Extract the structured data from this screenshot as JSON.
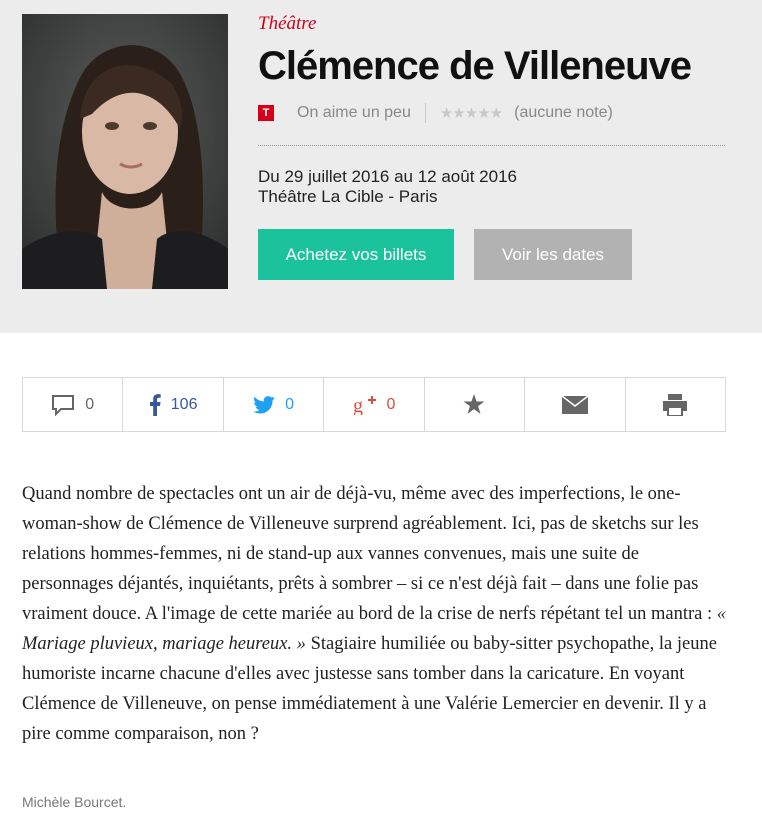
{
  "header": {
    "category": "Théâtre",
    "title": "Clémence de Villeneuve",
    "brand_badge": "T",
    "verdict": "On aime un peu",
    "stars": "★★★★★",
    "rating_note": "(aucune note)",
    "dates": "Du 29 juillet 2016 au 12 août 2016",
    "venue": "Théâtre La Cible - Paris",
    "buy_label": "Achetez vos billets",
    "dates_label": "Voir les dates"
  },
  "share": {
    "comments_count": "0",
    "facebook_count": "106",
    "twitter_count": "0",
    "googleplus_count": "0"
  },
  "article": {
    "text_before_quote": "Quand nombre de spectacles ont un air de déjà-vu, même avec des imperfections, le one-woman-show de Clémence de Villeneuve surprend agréablement. Ici, pas de sketchs sur les relations hommes-femmes, ni de stand-up aux vannes convenues, mais une suite de personnages déjantés, inquiétants, prêts à sombrer – si ce n'est déjà fait – dans une folie pas vraiment douce. A l'image de cette mariée au bord de la crise de nerfs répétant tel un mantra : ",
    "quote": "« Mariage pluvieux, mariage heureux. »",
    "text_after_quote": " Stagiaire humiliée ou baby-sitter psychopathe, la jeune humoriste incarne chacune d'elles avec justesse sans tomber dans la caricature. En voyant Clémence de Villeneuve, on pense immédiatement à une Valérie Lemercier en devenir. Il y a pire comme comparaison, non ?",
    "author": "Michèle Bourcet."
  },
  "colors": {
    "accent_red": "#d4001a",
    "buy_button": "#1bc39c",
    "dates_button": "#b2b2b2",
    "hero_background": "#ececec"
  },
  "icons": [
    "comment-icon",
    "facebook-icon",
    "twitter-icon",
    "googleplus-icon",
    "favorite-star-icon",
    "email-icon",
    "print-icon"
  ]
}
